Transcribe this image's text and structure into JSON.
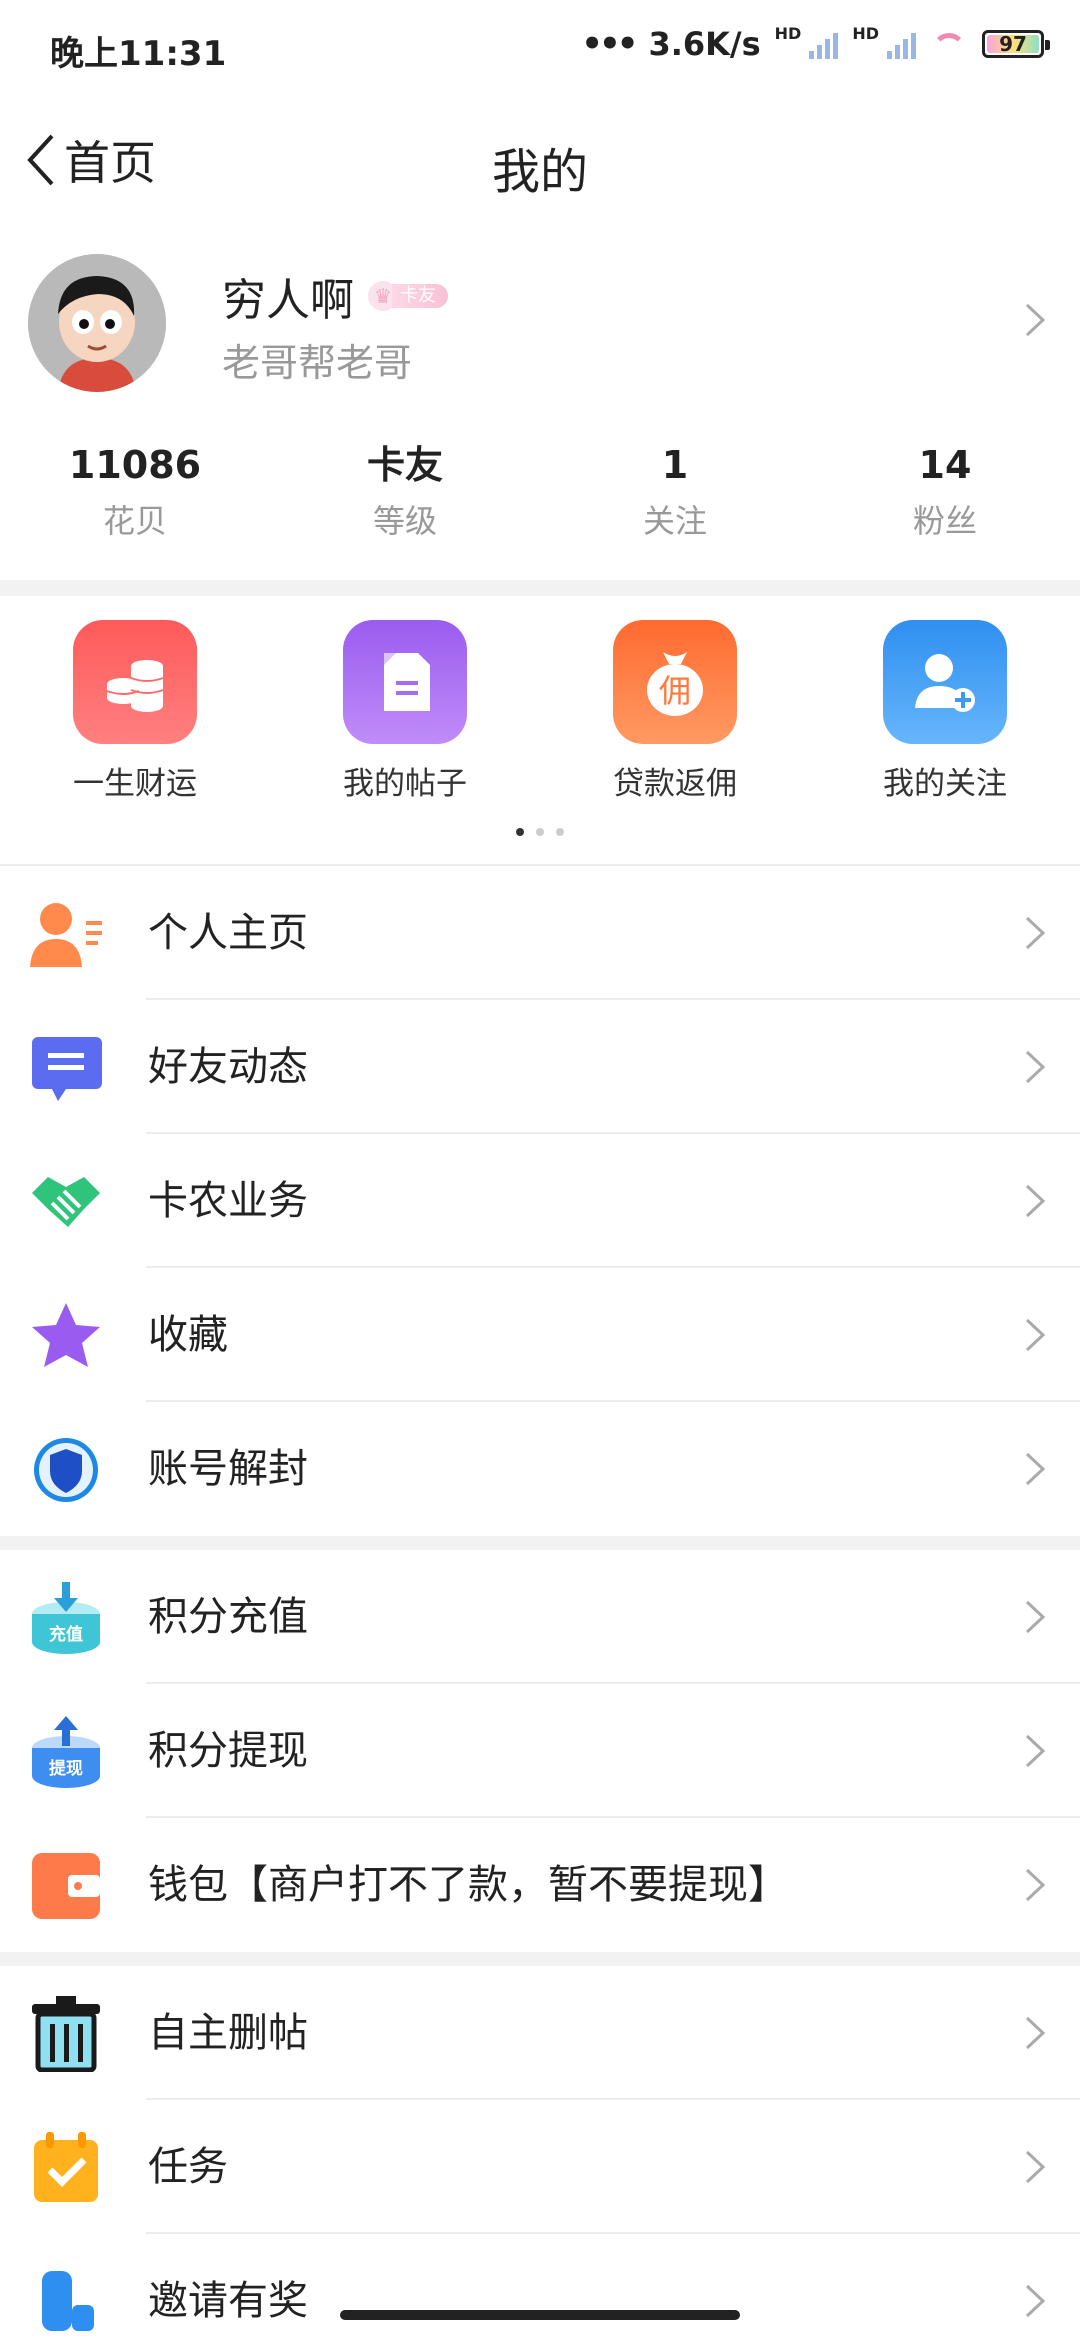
{
  "status_bar": {
    "time": "晚上11:31",
    "network_speed": "3.6K/s",
    "hd_1": "HD",
    "hd_2": "HD",
    "battery": "97"
  },
  "nav": {
    "back_label": "首页",
    "title": "我的"
  },
  "profile": {
    "username": "穷人啊",
    "badge": "卡友",
    "signature": "老哥帮老哥"
  },
  "stats": [
    {
      "value": "11086",
      "label": "花贝"
    },
    {
      "value": "卡友",
      "label": "等级"
    },
    {
      "value": "1",
      "label": "关注"
    },
    {
      "value": "14",
      "label": "粉丝"
    }
  ],
  "quick_actions": [
    {
      "label": "一生财运",
      "icon": "coins-icon",
      "color": "#ff6b6b"
    },
    {
      "label": "我的帖子",
      "icon": "document-icon",
      "color": "#a66cf2"
    },
    {
      "label": "贷款返佣",
      "icon": "money-bag-icon",
      "color": "#ff7a3d",
      "icon_text": "佣"
    },
    {
      "label": "我的关注",
      "icon": "add-user-icon",
      "color": "#3d9bf5"
    }
  ],
  "carousel": {
    "pages": 3,
    "active_page": 1
  },
  "menu_group_1": [
    {
      "label": "个人主页",
      "icon": "person-card-icon"
    },
    {
      "label": "好友动态",
      "icon": "chat-bubble-icon"
    },
    {
      "label": "卡农业务",
      "icon": "handshake-icon"
    },
    {
      "label": "收藏",
      "icon": "star-icon"
    },
    {
      "label": "账号解封",
      "icon": "shield-icon"
    }
  ],
  "menu_group_2": [
    {
      "label": "积分充值",
      "icon": "recharge-icon",
      "icon_text": "充值"
    },
    {
      "label": "积分提现",
      "icon": "withdraw-icon",
      "icon_text": "提现"
    },
    {
      "label": "钱包【商户打不了款，暂不要提现】",
      "icon": "wallet-icon"
    }
  ],
  "menu_group_3": [
    {
      "label": "自主删帖",
      "icon": "trash-icon"
    },
    {
      "label": "任务",
      "icon": "calendar-check-icon"
    },
    {
      "label": "邀请有奖",
      "icon": "gift-icon"
    }
  ]
}
